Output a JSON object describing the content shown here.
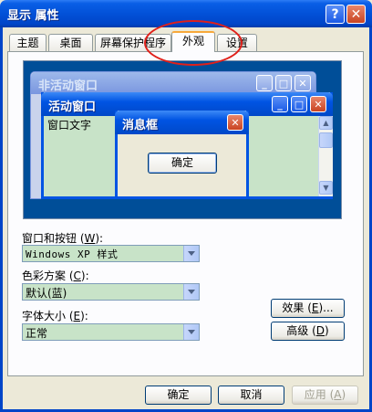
{
  "window": {
    "title": "显示 属性",
    "help": "?",
    "close": "✕"
  },
  "tabs": [
    {
      "label": "主题"
    },
    {
      "label": "桌面"
    },
    {
      "label": "屏幕保护程序"
    },
    {
      "label": "外观"
    },
    {
      "label": "设置"
    }
  ],
  "preview": {
    "inactive_title": "非活动窗口",
    "active_title": "活动窗口",
    "window_text": "窗口文字",
    "message_title": "消息框",
    "message_ok": "确定",
    "min": "_",
    "max": "□",
    "close": "✕"
  },
  "form": {
    "windows_buttons": {
      "label_pre": "窗口和按钮 (",
      "key": "W",
      "label_post": "):",
      "value": "Windows XP 样式"
    },
    "color_scheme": {
      "label_pre": "色彩方案 (",
      "key": "C",
      "label_post": "):",
      "value": "默认(蓝)"
    },
    "font_size": {
      "label_pre": "字体大小 (",
      "key": "E",
      "label_post": "):",
      "value": "正常"
    },
    "effects": {
      "pre": "效果 (",
      "key": "E",
      "post": ")..."
    },
    "advanced": {
      "pre": "高级 (",
      "key": "D",
      "post": ")"
    }
  },
  "footer": {
    "ok": "确定",
    "cancel": "取消",
    "apply_pre": "应用 (",
    "apply_key": "A",
    "apply_post": ")"
  },
  "colors": {
    "accent": "#0054e3",
    "highlight_circle": "#e0201a",
    "window_bg": "#c8e3c8"
  }
}
